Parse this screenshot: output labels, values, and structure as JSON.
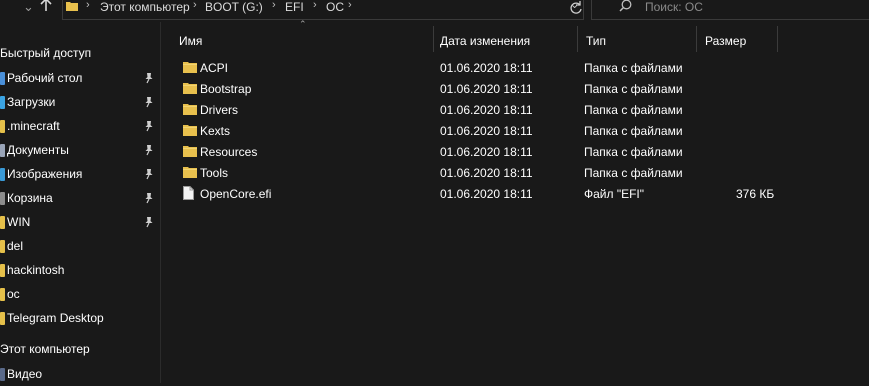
{
  "address": {
    "crumbs": [
      "Этот компьютер",
      "BOOT (G:)",
      "EFI",
      "OC"
    ]
  },
  "search": {
    "placeholder": "Поиск: OC"
  },
  "sidebar": {
    "quick_access": "Быстрый доступ",
    "items": [
      {
        "label": "Рабочий стол",
        "pinned": true,
        "color": "#4a90d9"
      },
      {
        "label": "Загрузки",
        "pinned": true,
        "color": "#3ba4e3"
      },
      {
        "label": ".minecraft",
        "pinned": true,
        "color": "#e5c04a"
      },
      {
        "label": "Документы",
        "pinned": true,
        "color": "#9aa5b8"
      },
      {
        "label": "Изображения",
        "pinned": true,
        "color": "#3a9ad6"
      },
      {
        "label": "Корзина",
        "pinned": true,
        "color": "#8c8c8c"
      },
      {
        "label": "WIN",
        "pinned": true,
        "color": "#e5c04a"
      },
      {
        "label": "del",
        "pinned": false,
        "color": "#e5c04a"
      },
      {
        "label": "hackintosh",
        "pinned": false,
        "color": "#e5c04a"
      },
      {
        "label": "oc",
        "pinned": false,
        "color": "#e5c04a"
      },
      {
        "label": "Telegram Desktop",
        "pinned": false,
        "color": "#e5c04a"
      }
    ],
    "this_pc": "Этот компьютер",
    "pc_items": [
      {
        "label": "Видео",
        "color": "#5a6a8a"
      }
    ]
  },
  "columns": {
    "name": "Имя",
    "date": "Дата изменения",
    "type": "Тип",
    "size": "Размер"
  },
  "files": [
    {
      "name": "ACPI",
      "date": "01.06.2020 18:11",
      "type": "Папка с файлами",
      "size": "",
      "kind": "folder"
    },
    {
      "name": "Bootstrap",
      "date": "01.06.2020 18:11",
      "type": "Папка с файлами",
      "size": "",
      "kind": "folder"
    },
    {
      "name": "Drivers",
      "date": "01.06.2020 18:11",
      "type": "Папка с файлами",
      "size": "",
      "kind": "folder"
    },
    {
      "name": "Kexts",
      "date": "01.06.2020 18:11",
      "type": "Папка с файлами",
      "size": "",
      "kind": "folder"
    },
    {
      "name": "Resources",
      "date": "01.06.2020 18:11",
      "type": "Папка с файлами",
      "size": "",
      "kind": "folder"
    },
    {
      "name": "Tools",
      "date": "01.06.2020 18:11",
      "type": "Папка с файлами",
      "size": "",
      "kind": "folder"
    },
    {
      "name": "OpenCore.efi",
      "date": "01.06.2020 18:11",
      "type": "Файл \"EFI\"",
      "size": "376 КБ",
      "kind": "file"
    }
  ],
  "colors": {
    "background": "#191919",
    "folder": "#e8c04d",
    "text": "#ffffff"
  }
}
